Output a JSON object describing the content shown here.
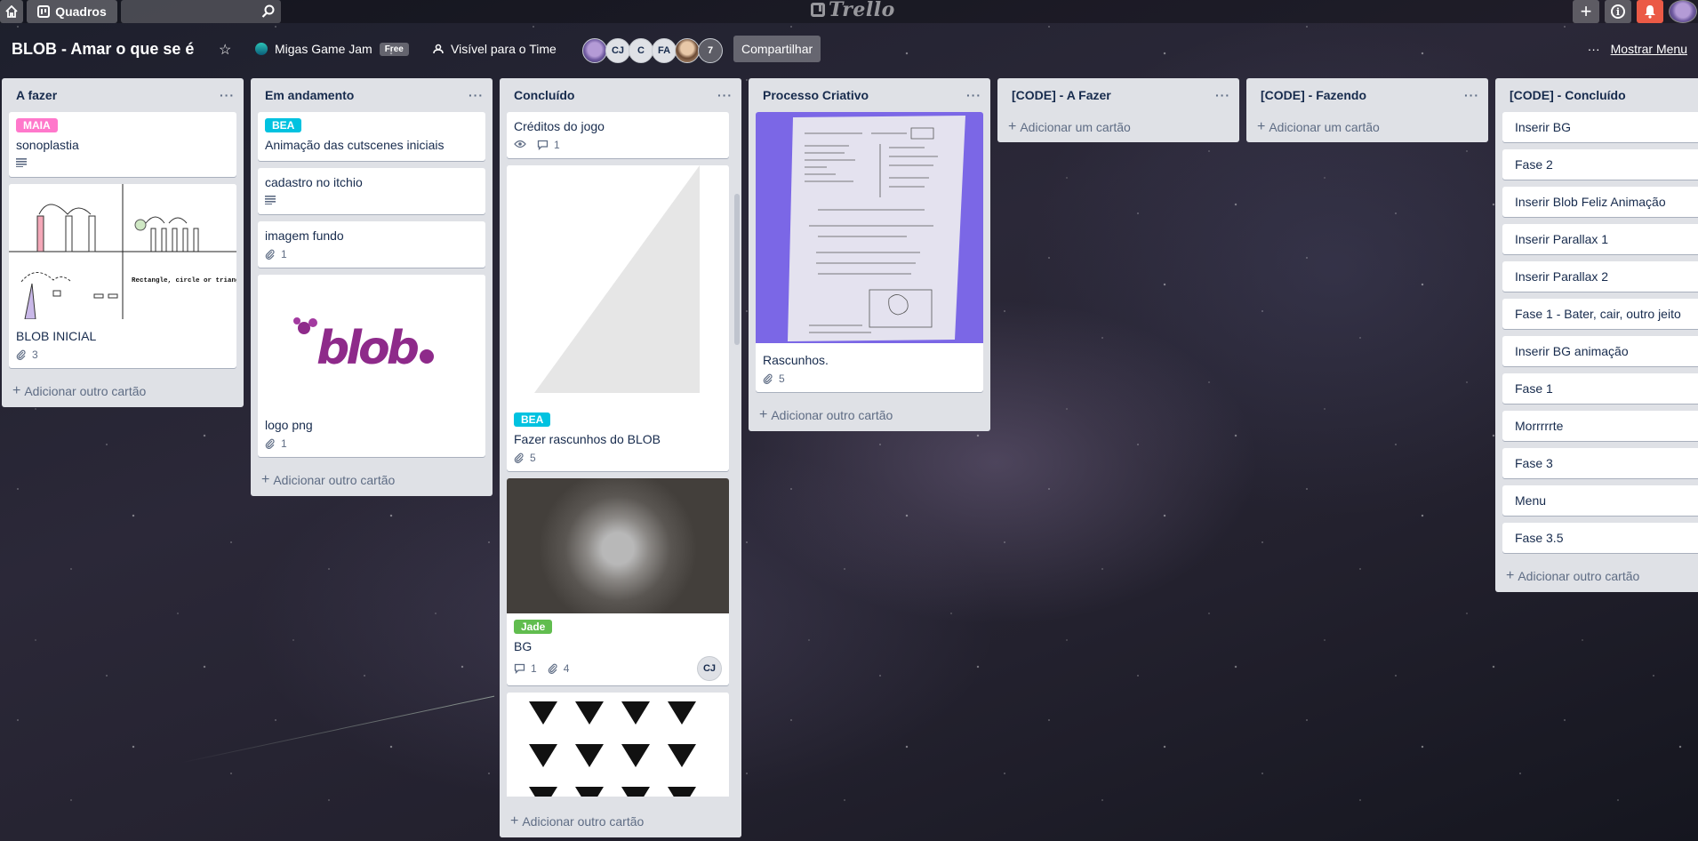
{
  "topbar": {
    "boards_label": "Quadros",
    "logo_text": "Trello"
  },
  "board": {
    "title": "BLOB - Amar o que se é",
    "team_name": "Migas Game Jam",
    "team_plan": "Free",
    "visibility": "Visível para o Time",
    "members": [
      "CJ",
      "C",
      "FA"
    ],
    "extra_members": "7",
    "share_label": "Compartilhar",
    "show_menu_label": "Mostrar Menu"
  },
  "lists": [
    {
      "title": "A fazer",
      "cards": [
        {
          "label": "MAIA",
          "label_color": "#ff78cb",
          "title": "sonoplastia",
          "has_description": true
        },
        {
          "title": "BLOB INICIAL",
          "cover": "sketch",
          "attachments": "3",
          "cover_text": "Rectangle, circle or triangle: It's easy!"
        }
      ],
      "add_label": "Adicionar outro cartão"
    },
    {
      "title": "Em andamento",
      "cards": [
        {
          "label": "BEA",
          "label_color": "#00c2e0",
          "title": "Animação das cutscenes iniciais"
        },
        {
          "title": "cadastro no itchio",
          "has_description": true
        },
        {
          "title": "imagem fundo",
          "attachments": "1"
        },
        {
          "title": "logo png",
          "cover": "blob-logo",
          "attachments": "1",
          "cover_text": "blob"
        }
      ],
      "add_label": "Adicionar outro cartão"
    },
    {
      "title": "Concluído",
      "cards": [
        {
          "title": "Créditos do jogo",
          "watching": true,
          "comments": "1"
        },
        {
          "label": "BEA",
          "label_color": "#00c2e0",
          "title": "Fazer rascunhos do BLOB",
          "cover": "triangle",
          "attachments": "5"
        },
        {
          "label": "Jade",
          "label_color": "#61bd4f",
          "title": "BG",
          "cover": "glow",
          "comments": "1",
          "attachments": "4",
          "member": "CJ"
        },
        {
          "cover": "triangles"
        }
      ],
      "add_label": "Adicionar outro cartão"
    },
    {
      "title": "Processo Criativo",
      "cards": [
        {
          "title": "Rascunhos.",
          "cover": "paper",
          "attachments": "5"
        }
      ],
      "add_label": "Adicionar outro cartão"
    },
    {
      "title": "[CODE] - A Fazer",
      "cards": [],
      "add_label": "Adicionar um cartão"
    },
    {
      "title": "[CODE] - Fazendo",
      "cards": [],
      "add_label": "Adicionar um cartão"
    },
    {
      "title": "[CODE] - Concluído",
      "cards": [
        {
          "title": "Inserir BG"
        },
        {
          "title": "Fase 2"
        },
        {
          "title": "Inserir Blob Feliz Animação"
        },
        {
          "title": "Inserir Parallax 1"
        },
        {
          "title": "Inserir Parallax 2"
        },
        {
          "title": "Fase 1 - Bater, cair, outro jeito"
        },
        {
          "title": "Inserir BG animação"
        },
        {
          "title": "Fase 1"
        },
        {
          "title": "Morrrrrte"
        },
        {
          "title": "Fase 3"
        },
        {
          "title": "Menu"
        },
        {
          "title": "Fase 3.5"
        }
      ],
      "add_label": "Adicionar outro cartão"
    }
  ]
}
